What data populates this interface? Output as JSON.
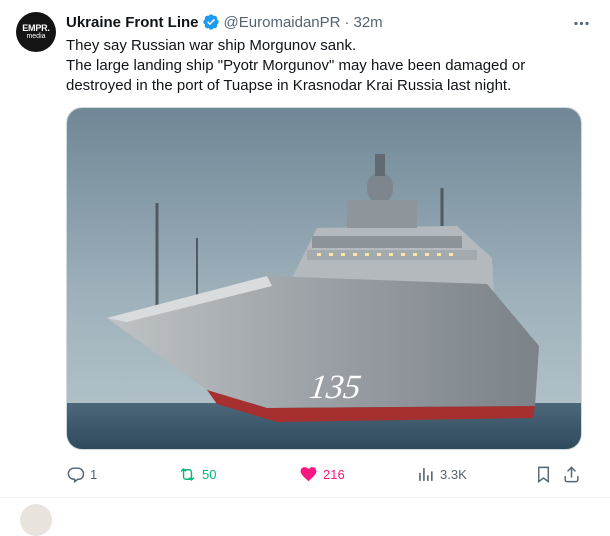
{
  "author": {
    "avatar_line1": "EMPR.",
    "avatar_line2": "media",
    "name": "Ukraine Front Line",
    "handle": "@EuromaidanPR",
    "separator": "·",
    "time": "32m"
  },
  "post": {
    "lines": [
      "They say Russian war ship Morgunov sank.",
      "The large landing ship \"Pyotr Morgunov\" may have been damaged or",
      "destroyed in the port of Tuapse in Krasnodar Krai Russia last night."
    ],
    "image_hull_number": "135"
  },
  "actions": {
    "replies": "1",
    "reposts": "50",
    "likes": "216",
    "views": "3.3K"
  },
  "colors": {
    "text": "#0f1419",
    "secondary": "#536471",
    "verified": "#1d9bf0",
    "repost": "#00ba7c",
    "like": "#f91880"
  }
}
